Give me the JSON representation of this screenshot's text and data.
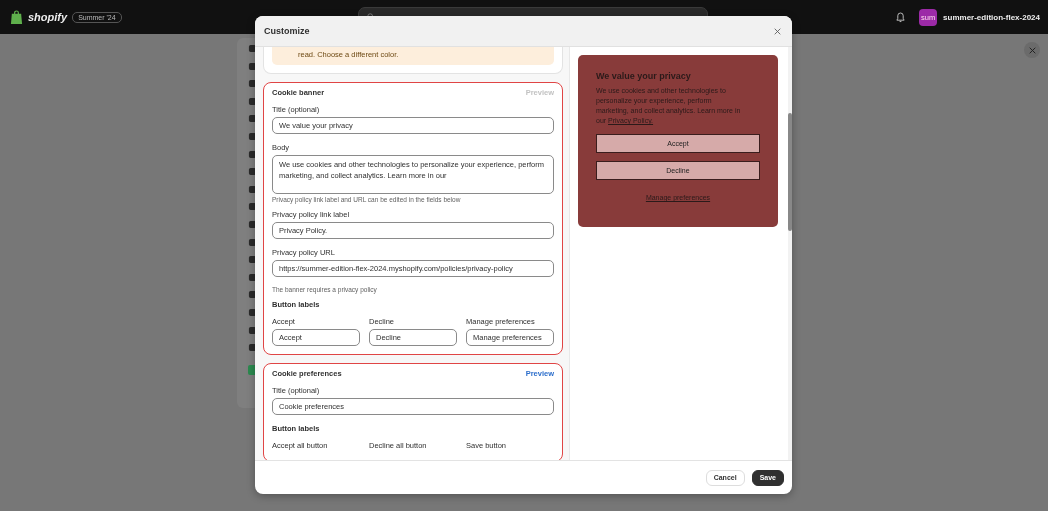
{
  "topbar": {
    "brand": "shopify",
    "edition_badge": "Summer '24",
    "store": {
      "avatar": "sum",
      "name": "summer-edition-flex-2024"
    }
  },
  "modal": {
    "title": "Customize",
    "warning": "read. Choose a different color.",
    "sections": [
      {
        "title": "Cookie banner",
        "preview": "Preview",
        "preview_disabled": true,
        "highlighted": true,
        "items": [
          {
            "kind": "field",
            "label": "Title (optional)",
            "value": "We value your privacy"
          },
          {
            "kind": "textarea",
            "label": "Body",
            "value": "We use cookies and other technologies to personalize your experience, perform marketing, and collect analytics. Learn more in our"
          },
          {
            "kind": "help",
            "text": "Privacy policy link label and URL can be edited in the fields below"
          },
          {
            "kind": "field",
            "label": "Privacy policy link label",
            "value": "Privacy Policy."
          },
          {
            "kind": "field",
            "label": "Privacy policy URL",
            "value": "https://summer-edition-flex-2024.myshopify.com/policies/privacy-policy"
          },
          {
            "kind": "help",
            "text": "The banner requires a privacy policy"
          },
          {
            "kind": "subheading",
            "text": "Button labels"
          },
          {
            "kind": "row",
            "fields": [
              {
                "label": "Accept",
                "value": "Accept"
              },
              {
                "label": "Decline",
                "value": "Decline"
              },
              {
                "label": "Manage preferences",
                "value": "Manage preferences"
              }
            ]
          }
        ]
      },
      {
        "title": "Cookie preferences",
        "preview": "Preview",
        "preview_disabled": false,
        "highlighted": true,
        "items": [
          {
            "kind": "field",
            "label": "Title (optional)",
            "value": "Cookie preferences"
          },
          {
            "kind": "subheading",
            "text": "Button labels"
          },
          {
            "kind": "row",
            "fields": [
              {
                "label": "Accept all button"
              },
              {
                "label": "Decline all button"
              },
              {
                "label": "Save button"
              }
            ]
          }
        ]
      }
    ],
    "preview": {
      "title": "We value your privacy",
      "body": "We use cookies and other technologies to personalize your experience, perform marketing, and collect analytics. Learn more in our",
      "link": "Privacy Policy.",
      "buttons": [
        "Accept",
        "Decline"
      ],
      "manage_link": "Manage preferences",
      "color": "#883b3a"
    },
    "footer_buttons": [
      {
        "label": "Cancel",
        "kind": "secondary"
      },
      {
        "label": "Save",
        "kind": "primary"
      }
    ]
  }
}
